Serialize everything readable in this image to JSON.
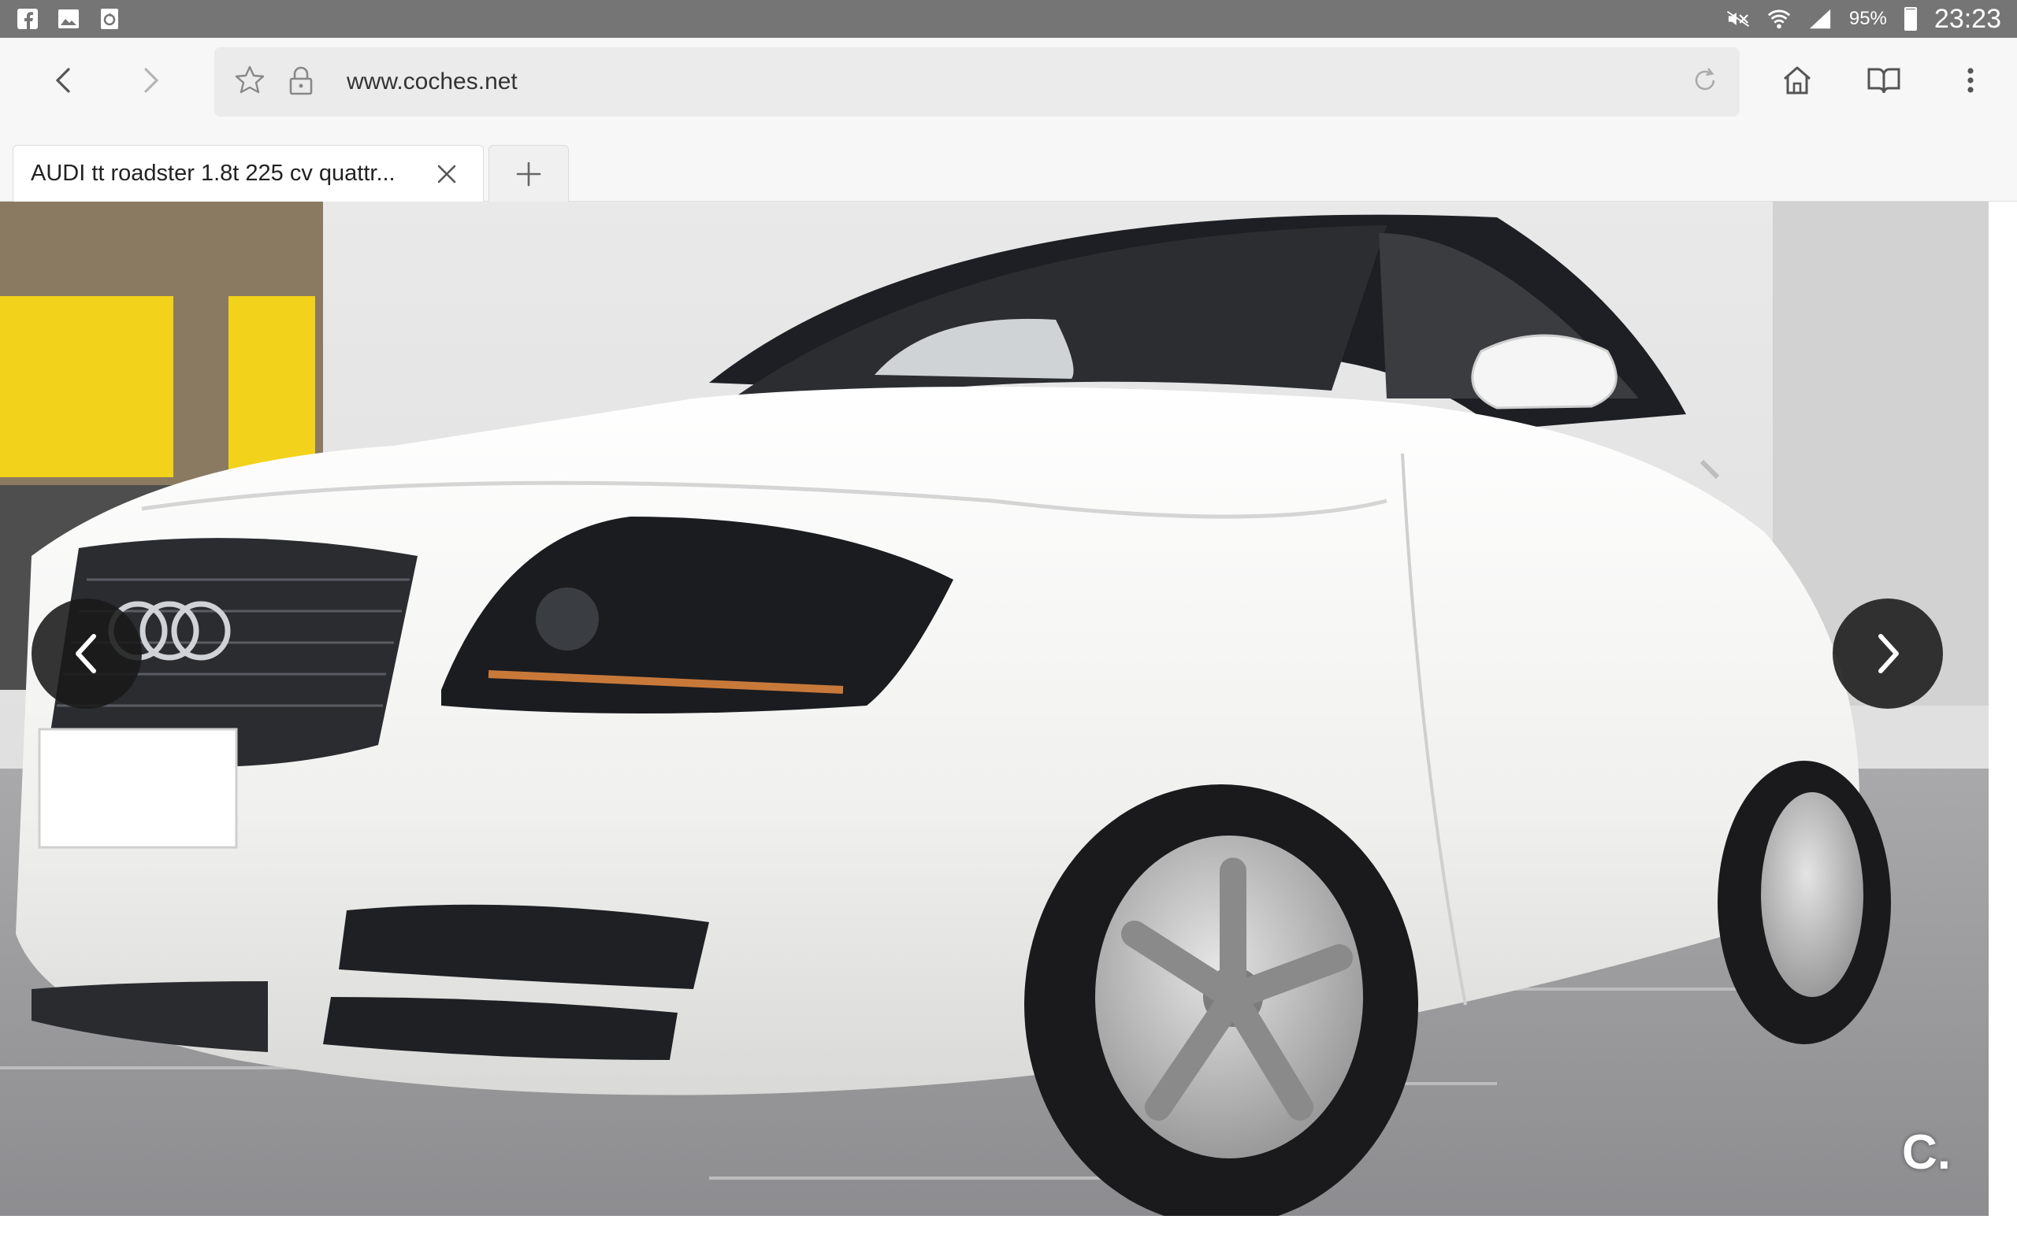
{
  "status_bar": {
    "battery_percent": "95%",
    "battery_level": 0.95,
    "time": "23:23",
    "left_icons": [
      "facebook-icon",
      "gallery-icon",
      "recycle-icon"
    ],
    "right_icons": [
      "mute-icon",
      "wifi-icon",
      "signal-icon",
      "battery-icon"
    ]
  },
  "toolbar": {
    "url": "www.coches.net",
    "icons": [
      "back-icon",
      "forward-icon",
      "bookmark-star-icon",
      "lock-icon",
      "reload-icon",
      "home-icon",
      "reader-book-icon",
      "more-vert-icon"
    ]
  },
  "tabs": [
    {
      "title": "AUDI tt roadster 1.8t 225 cv quattr..."
    }
  ],
  "gallery": {
    "watermark": "C.",
    "icons": [
      "chevron-left-icon",
      "chevron-right-icon"
    ]
  },
  "colors": {
    "status_bar": "#757575",
    "toolbar": "#f7f7f7",
    "url_bar": "#ebebeb",
    "car_body": "#f4f4f2",
    "arrow_bg": "#191919"
  }
}
